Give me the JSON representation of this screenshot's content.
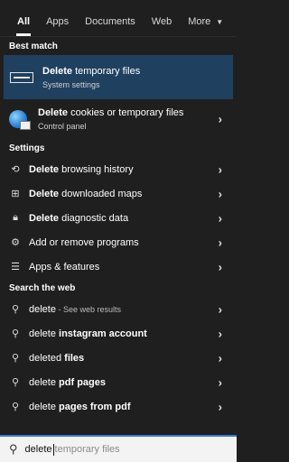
{
  "tabs": [
    {
      "label": "All",
      "active": true
    },
    {
      "label": "Apps"
    },
    {
      "label": "Documents"
    },
    {
      "label": "Web"
    },
    {
      "label": "More"
    }
  ],
  "sections": {
    "best_match": "Best match",
    "settings": "Settings",
    "web": "Search the web"
  },
  "best": {
    "bold": "Delete",
    "rest": " temporary files",
    "sub": "System settings",
    "icon": "display-settings-icon"
  },
  "cookie": {
    "bold": "Delete",
    "rest": " cookies or temporary files",
    "sub": "Control panel",
    "icon": "internet-options-globe-icon"
  },
  "settings": [
    {
      "bold": "Delete",
      "rest": " browsing history",
      "icon": "browser-history-icon"
    },
    {
      "bold": "Delete",
      "rest": " downloaded maps",
      "icon": "map-icon"
    },
    {
      "bold": "Delete",
      "rest": " diagnostic data",
      "icon": "lock-icon"
    },
    {
      "bold": "",
      "rest": "Add or remove programs",
      "icon": "gear-icon"
    },
    {
      "bold": "",
      "rest": "Apps & features",
      "icon": "list-icon"
    }
  ],
  "web": [
    {
      "pre": "delete",
      "bold": "",
      "suffix": " - See web results"
    },
    {
      "pre": "delete ",
      "bold": "instagram account",
      "suffix": ""
    },
    {
      "pre": "deleted ",
      "bold": "files",
      "suffix": ""
    },
    {
      "pre": "delete ",
      "bold": "pdf pages",
      "suffix": ""
    },
    {
      "pre": "delete ",
      "bold": "pages from pdf",
      "suffix": ""
    }
  ],
  "search": {
    "typed": "delete",
    "suggestion": "temporary files"
  },
  "colors": {
    "background": "#1f1f1f",
    "highlight": "#204060",
    "accent": "#3a7bd5"
  }
}
